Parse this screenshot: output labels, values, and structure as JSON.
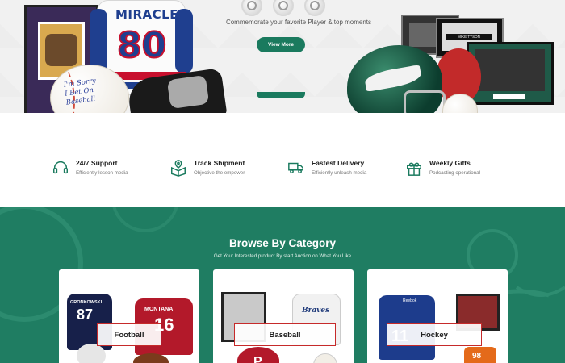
{
  "hero": {
    "tagline": "Commemorate your favorite Player & top moments",
    "view_more_label": "View More",
    "memorabilia_text": {
      "jersey_word": "MIRACLE",
      "jersey_number": "80",
      "ball_signature_line1": "I'm Sorry",
      "ball_signature_line2": "I Bet On",
      "ball_signature_line3": "Baseball",
      "frame_label": "MIKE TYSON"
    }
  },
  "features": [
    {
      "title": "24/7 Support",
      "subtitle": "Efficiently lesson media",
      "icon": "headset-icon"
    },
    {
      "title": "Track Shipment",
      "subtitle": "Objective the empower",
      "icon": "package-location-icon"
    },
    {
      "title": "Fastest Delivery",
      "subtitle": "Efficiently unleash media",
      "icon": "delivery-truck-icon"
    },
    {
      "title": "Weekly Gifts",
      "subtitle": "Podcasting operational",
      "icon": "gift-icon"
    }
  ],
  "category_section": {
    "title": "Browse By Category",
    "subtitle": "Get Your Interested product By start Auction on What You Like",
    "cards": [
      {
        "label": "Football",
        "jersey_texts": [
          "GRONKOWSKI",
          "87",
          "MONTANA",
          "16"
        ]
      },
      {
        "label": "Baseball",
        "jersey_texts": [
          "Braves",
          "P"
        ]
      },
      {
        "label": "Hockey",
        "jersey_texts": [
          "Reebok",
          "11",
          "98"
        ]
      }
    ]
  },
  "colors": {
    "brand_green": "#1a7a5e",
    "category_bg": "#1f7d62",
    "label_border_red": "#c62a2a"
  }
}
